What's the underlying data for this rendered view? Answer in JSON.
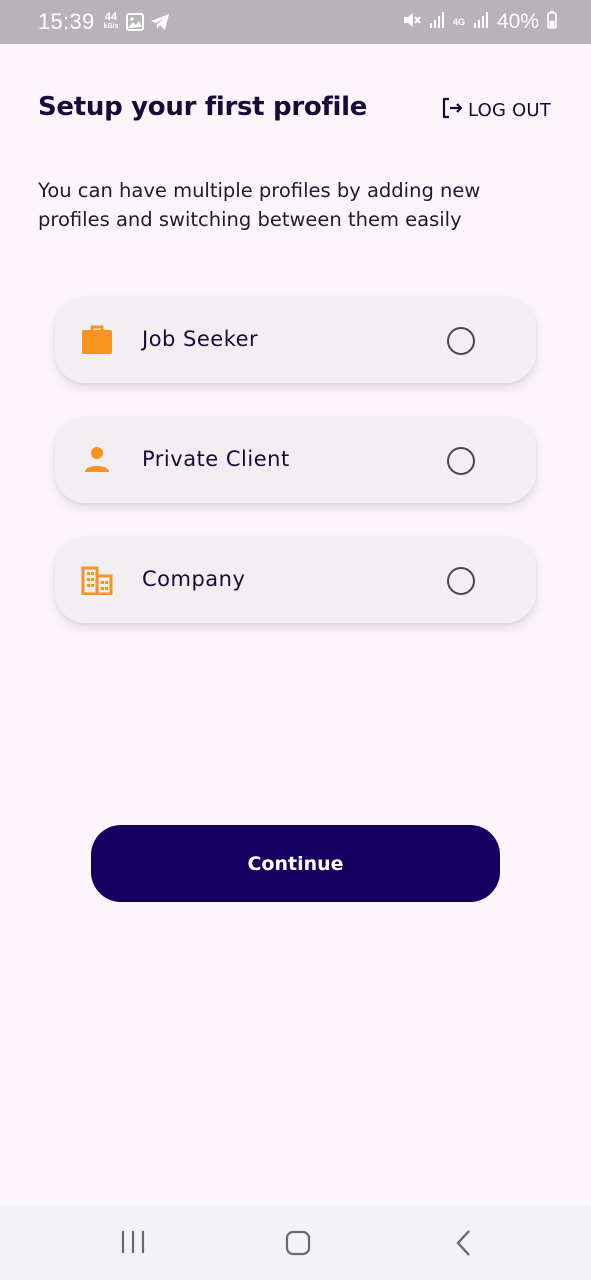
{
  "status_bar": {
    "time": "15:39",
    "net_speed": "44",
    "net_speed_unit": "kB/s",
    "network_type": "4G",
    "battery": "40%"
  },
  "header": {
    "title": "Setup your first profile",
    "logout_label": "LOG OUT"
  },
  "subtitle": "You can have multiple profiles by adding new profiles and switching between them easily",
  "profiles": [
    {
      "label": "Job Seeker",
      "icon": "briefcase-icon",
      "selected": false
    },
    {
      "label": "Private Client",
      "icon": "person-icon",
      "selected": false
    },
    {
      "label": "Company",
      "icon": "building-icon",
      "selected": false
    }
  ],
  "continue_label": "Continue",
  "colors": {
    "accent": "#f7931e",
    "primary": "#130060",
    "background": "#fcf6fc",
    "card": "#f2eff2"
  }
}
